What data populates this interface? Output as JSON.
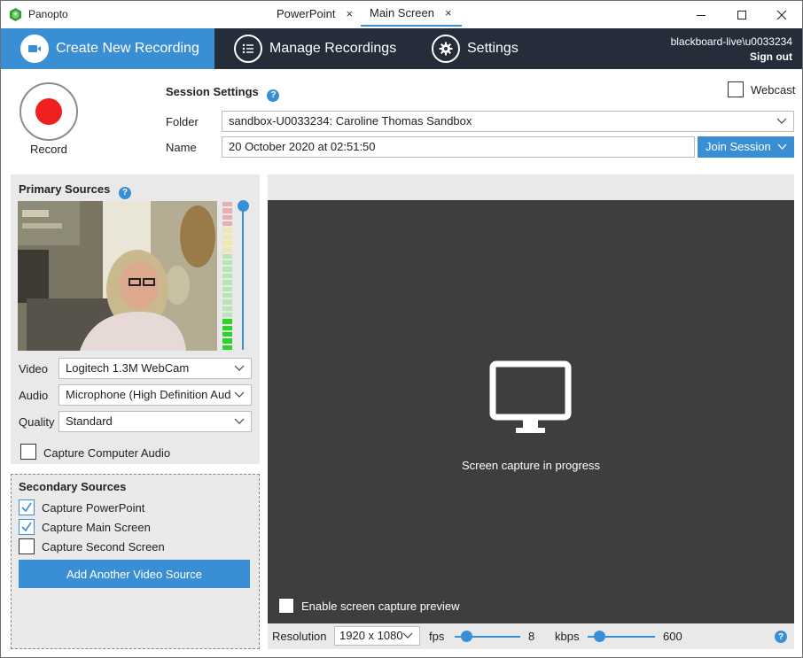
{
  "window": {
    "title": "Panopto",
    "minimize_icon": "minimize-icon",
    "maximize_icon": "maximize-icon",
    "close_icon": "close-icon"
  },
  "nav": {
    "tabs": [
      {
        "label": "Create New Recording",
        "icon": "video-camera-icon",
        "active": true
      },
      {
        "label": "Manage Recordings",
        "icon": "list-icon",
        "active": false
      },
      {
        "label": "Settings",
        "icon": "gear-icon",
        "active": false
      }
    ],
    "account": "blackboard-live\\u0033234",
    "sign_out": "Sign out"
  },
  "record": {
    "label": "Record"
  },
  "session": {
    "title": "Session Settings",
    "help": "?",
    "webcast_label": "Webcast",
    "webcast_checked": false,
    "folder_label": "Folder",
    "folder_value": "sandbox-U0033234: Caroline Thomas Sandbox",
    "name_label": "Name",
    "name_value": "20 October 2020 at 02:51:50",
    "join_label": "Join Session"
  },
  "primary": {
    "title": "Primary Sources",
    "help": "?",
    "video_label": "Video",
    "video_value": "Logitech 1.3M WebCam",
    "audio_label": "Audio",
    "audio_value": "Microphone (High Definition Aud",
    "quality_label": "Quality",
    "quality_value": "Standard",
    "computer_audio_label": "Capture Computer Audio",
    "computer_audio_checked": false,
    "audio_level_segments_lit": 5,
    "volume_level": 1.0
  },
  "secondary": {
    "title": "Secondary Sources",
    "items": [
      {
        "label": "Capture PowerPoint",
        "checked": true
      },
      {
        "label": "Capture Main Screen",
        "checked": true
      },
      {
        "label": "Capture Second Screen",
        "checked": false
      }
    ],
    "add_button": "Add Another Video Source"
  },
  "preview": {
    "tabs": [
      {
        "label": "PowerPoint",
        "close": "×",
        "active": false
      },
      {
        "label": "Main Screen",
        "close": "×",
        "active": true
      }
    ],
    "status": "Screen capture in progress",
    "monitor_icon": "monitor-icon",
    "enable_preview_label": "Enable screen capture preview",
    "enable_preview_checked": false
  },
  "capture_settings": {
    "resolution_label": "Resolution",
    "resolution_value": "1920 x 1080",
    "fps_label": "fps",
    "fps_value": "8",
    "kbps_label": "kbps",
    "kbps_value": "600",
    "help": "?"
  },
  "colors": {
    "accent": "#3a8fd4",
    "navbar": "#252d3a",
    "record_red": "#f02020",
    "preview_bg": "#3e3e3e",
    "panel_bg": "#e9e9e9"
  }
}
